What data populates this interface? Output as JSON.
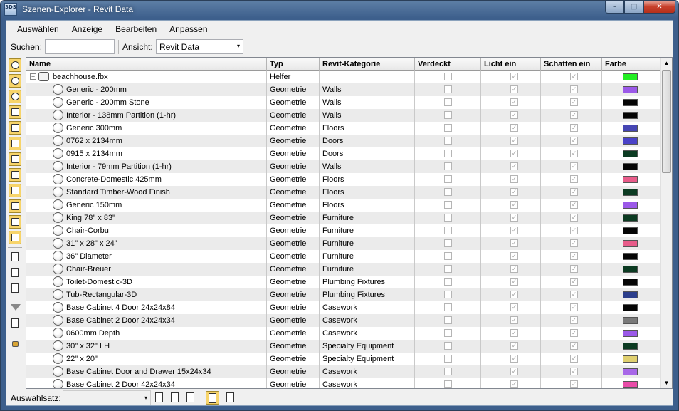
{
  "window": {
    "title": "Szenen-Explorer - Revit Data",
    "app_icon": "3DS",
    "minimize": "–",
    "maximize": "□",
    "close": "✕"
  },
  "menu": [
    "Auswählen",
    "Anzeige",
    "Bearbeiten",
    "Anpassen"
  ],
  "search": {
    "label": "Suchen:",
    "value": ""
  },
  "view": {
    "label": "Ansicht:",
    "value": "Revit Data"
  },
  "columns": {
    "name": "Name",
    "type": "Typ",
    "category": "Revit-Kategorie",
    "hidden": "Verdeckt",
    "light": "Licht ein",
    "shadow": "Schatten ein",
    "color": "Farbe"
  },
  "root": {
    "name": "beachhouse.fbx",
    "type": "Helfer",
    "category": "",
    "hidden": false,
    "light": true,
    "shadow": true,
    "color": "#22ee22"
  },
  "rows": [
    {
      "name": "Generic - 200mm",
      "type": "Geometrie",
      "category": "Walls",
      "color": "#9b59e8"
    },
    {
      "name": "Generic - 200mm Stone",
      "type": "Geometrie",
      "category": "Walls",
      "color": "#050505"
    },
    {
      "name": "Interior - 138mm Partition (1-hr)",
      "type": "Geometrie",
      "category": "Walls",
      "color": "#050505"
    },
    {
      "name": "Generic 300mm",
      "type": "Geometrie",
      "category": "Floors",
      "color": "#4646b4"
    },
    {
      "name": "0762 x 2134mm",
      "type": "Geometrie",
      "category": "Doors",
      "color": "#4a42c8"
    },
    {
      "name": "0915 x 2134mm",
      "type": "Geometrie",
      "category": "Doors",
      "color": "#0c3b22"
    },
    {
      "name": "Interior - 79mm Partition (1-hr)",
      "type": "Geometrie",
      "category": "Walls",
      "color": "#050505"
    },
    {
      "name": "Concrete-Domestic 425mm",
      "type": "Geometrie",
      "category": "Floors",
      "color": "#e85c8a"
    },
    {
      "name": "Standard Timber-Wood Finish",
      "type": "Geometrie",
      "category": "Floors",
      "color": "#0c3b22"
    },
    {
      "name": "Generic 150mm",
      "type": "Geometrie",
      "category": "Floors",
      "color": "#9b59e8"
    },
    {
      "name": "King 78\" x 83\"",
      "type": "Geometrie",
      "category": "Furniture",
      "color": "#0c3b22"
    },
    {
      "name": "Chair-Corbu",
      "type": "Geometrie",
      "category": "Furniture",
      "color": "#050505"
    },
    {
      "name": "31\" x 28\" x 24\"",
      "type": "Geometrie",
      "category": "Furniture",
      "color": "#e85c8a"
    },
    {
      "name": "36\" Diameter",
      "type": "Geometrie",
      "category": "Furniture",
      "color": "#050505"
    },
    {
      "name": "Chair-Breuer",
      "type": "Geometrie",
      "category": "Furniture",
      "color": "#0c3b22"
    },
    {
      "name": "Toilet-Domestic-3D",
      "type": "Geometrie",
      "category": "Plumbing Fixtures",
      "color": "#050505"
    },
    {
      "name": "Tub-Rectangular-3D",
      "type": "Geometrie",
      "category": "Plumbing Fixtures",
      "color": "#2c3e8c"
    },
    {
      "name": "Base Cabinet 4 Door 24x24x84",
      "type": "Geometrie",
      "category": "Casework",
      "color": "#050505"
    },
    {
      "name": "Base Cabinet 2 Door 24x24x34",
      "type": "Geometrie",
      "category": "Casework",
      "color": "#7a7a7a"
    },
    {
      "name": "0600mm Depth",
      "type": "Geometrie",
      "category": "Casework",
      "color": "#9b59e8"
    },
    {
      "name": "30\" x 32\" LH",
      "type": "Geometrie",
      "category": "Specialty Equipment",
      "color": "#0c3b22"
    },
    {
      "name": "22\" x 20\"",
      "type": "Geometrie",
      "category": "Specialty Equipment",
      "color": "#e0d070"
    },
    {
      "name": "Base Cabinet Door and Drawer 15x24x34",
      "type": "Geometrie",
      "category": "Casework",
      "color": "#a868e8"
    },
    {
      "name": "Base Cabinet 2 Door 42x24x34",
      "type": "Geometrie",
      "category": "Casework",
      "color": "#e84ca8"
    }
  ],
  "checkbox_glyph": "✓",
  "scroll": {
    "up": "▲",
    "down": "▼"
  },
  "status": {
    "label": "Auswahlsatz:",
    "value": ""
  },
  "dropdown_arrow": "▾",
  "toolbar_left_icons": [
    "geometry-icon",
    "shapes-icon",
    "lights-icon",
    "cameras-icon",
    "helpers-icon",
    "spacewarps-icon",
    "groups-icon",
    "xrefs-icon",
    "bones-icon",
    "containers-icon",
    "frozen-icon",
    "hidden-icon",
    "display-all-icon",
    "display-none-icon",
    "invert-icon",
    "filter-icon",
    "filter-options-icon",
    "lock-icon"
  ]
}
